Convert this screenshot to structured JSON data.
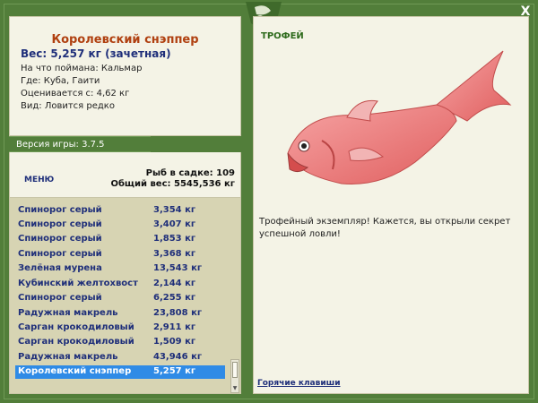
{
  "window": {
    "close_label": "X"
  },
  "fish_info": {
    "name": "Королевский снэппер",
    "weight": "Вес: 5,257 кг (зачетная)",
    "bait": "На что поймана: Кальмар",
    "location": "Где: Куба, Гаити",
    "value": "Оценивается с: 4,62 кг",
    "species": "Вид: Ловится редко"
  },
  "version": "Версия игры: 3.7.5",
  "menu_label": "МЕНЮ",
  "stats": {
    "count": "Рыб в садке: 109",
    "total_weight": "Общий вес: 5545,536 кг"
  },
  "catch_list": [
    {
      "name": "Спинорог серый",
      "weight": "3,354 кг"
    },
    {
      "name": "Спинорог серый",
      "weight": "3,407 кг"
    },
    {
      "name": "Спинорог серый",
      "weight": "1,853 кг"
    },
    {
      "name": "Спинорог серый",
      "weight": "3,368 кг"
    },
    {
      "name": "Зелёная мурена",
      "weight": "13,543 кг"
    },
    {
      "name": "Кубинский желтохвост",
      "weight": "2,144 кг"
    },
    {
      "name": "Спинорог серый",
      "weight": "6,255 кг"
    },
    {
      "name": "Радужная макрель",
      "weight": "23,808 кг"
    },
    {
      "name": "Сарган крокодиловый",
      "weight": "2,911 кг"
    },
    {
      "name": "Сарган крокодиловый",
      "weight": "1,509 кг"
    },
    {
      "name": "Радужная макрель",
      "weight": "43,946 кг"
    },
    {
      "name": "Королевский снэппер",
      "weight": "5,257 кг",
      "selected": true
    }
  ],
  "trophy": {
    "label": "ТРОФЕЙ",
    "description": "Трофейный экземпляр! Кажется, вы открыли секрет успешной ловли!",
    "hotkeys_label": "Горячие клавиши"
  },
  "colors": {
    "frame": "#527e3a",
    "panel": "#f4f3e6",
    "list_bg": "#d7d4b3",
    "fish_name": "#b04010",
    "link": "#1f2f7a",
    "selected_row": "#2f8be6",
    "trophy_label": "#2d6a1b"
  }
}
